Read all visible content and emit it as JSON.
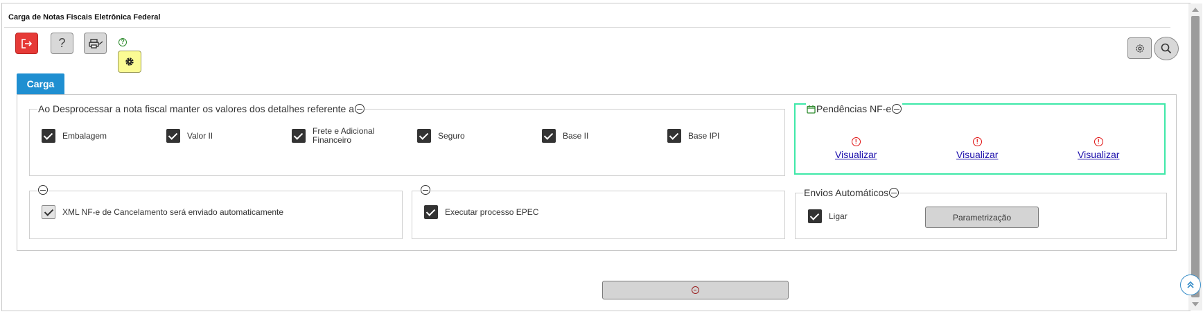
{
  "window": {
    "title": "Carga de Notas Fiscais Eletrônica Federal"
  },
  "toolbar": {
    "exit_icon": "exit-icon",
    "help_label": "?",
    "print_icon": "printer-icon",
    "config_icon": "gear-icon",
    "help_mini": "?",
    "right_settings_icon": "gear-icon",
    "right_search_icon": "search-icon"
  },
  "tabs": [
    {
      "label": "Carga"
    }
  ],
  "detalhes": {
    "legend": "Ao Desprocessar a nota fiscal manter os valores dos detalhes referente a",
    "items": [
      {
        "label": "Embalagem",
        "checked": true
      },
      {
        "label": "Valor II",
        "checked": true
      },
      {
        "label_line1": "Frete e Adicional",
        "label_line2": "Financeiro",
        "checked": true
      },
      {
        "label": "Seguro",
        "checked": true
      },
      {
        "label": "Base II",
        "checked": true
      },
      {
        "label": "Base IPI",
        "checked": true
      }
    ]
  },
  "pendencias": {
    "legend": "Pendências NF-e",
    "links": [
      {
        "label": "Visualizar"
      },
      {
        "label": "Visualizar"
      },
      {
        "label": "Visualizar"
      }
    ],
    "warn_glyph": "!"
  },
  "cancelamento": {
    "label": "XML NF-e de Cancelamento será enviado automaticamente",
    "checked": true
  },
  "epec": {
    "label": "Executar processo EPEC",
    "checked": true
  },
  "envios": {
    "legend": "Envios Automáticos",
    "ligar_label": "Ligar",
    "ligar_checked": true,
    "param_button": "Parametrização"
  },
  "colors": {
    "tab_blue": "#1f8fd1",
    "exit_red": "#e63a37",
    "config_yellow": "#fbfb94",
    "pend_border": "#3ee8a8",
    "link_blue": "#1a0dab",
    "warn_red": "#e01010"
  }
}
